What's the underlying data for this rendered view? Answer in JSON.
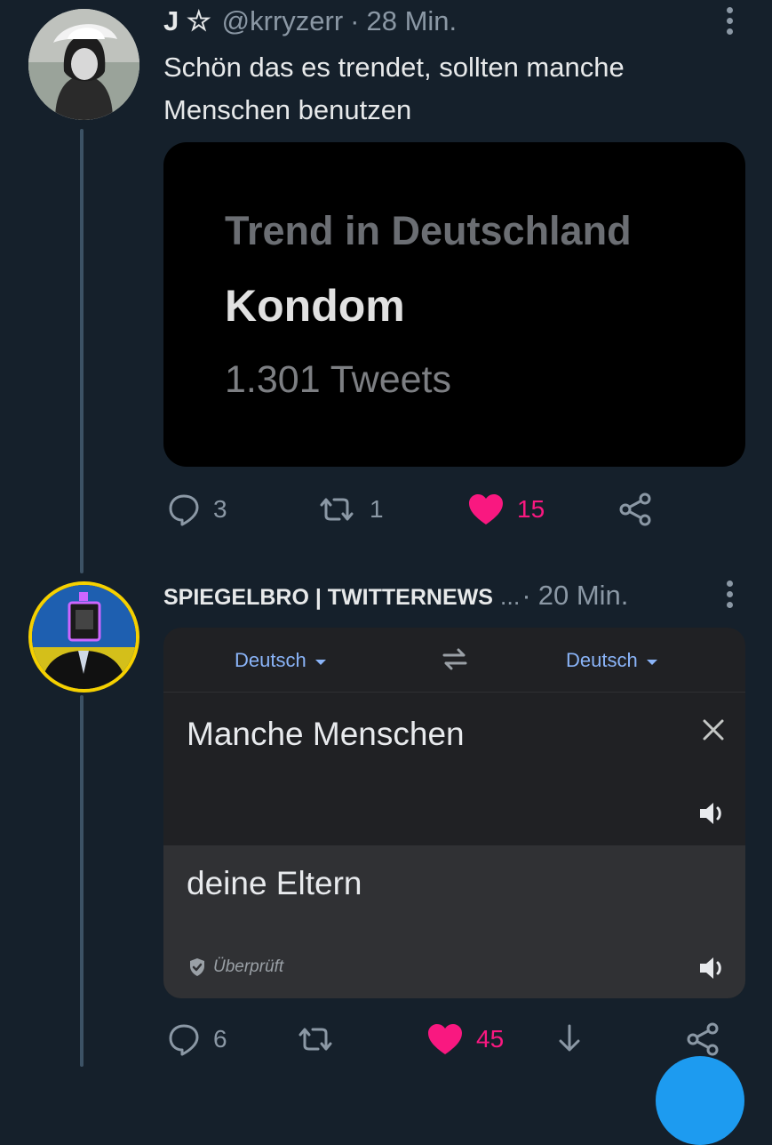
{
  "tweet1": {
    "name": "J ☆",
    "handle": "@krryzerr",
    "separator": "·",
    "time": "28 Min.",
    "text": "Schön das es trendet, sollten manche Menschen benutzen",
    "card": {
      "label": "Trend in Deutschland",
      "topic": "Kondom",
      "count": "1.301 Tweets"
    },
    "actions": {
      "replies": "3",
      "retweets": "1",
      "likes": "15"
    }
  },
  "tweet2": {
    "name": "SPIEGELBRO | TWITTERNEWS",
    "ellipsis": "...",
    "separator": "·",
    "time": "20 Min.",
    "translate": {
      "source_lang": "Deutsch",
      "target_lang": "Deutsch",
      "source_text": "Manche Menschen",
      "target_text": "deine Eltern",
      "verified_label": "Überprüft"
    },
    "actions": {
      "replies": "6",
      "likes": "45"
    }
  },
  "colors": {
    "background": "#15202b",
    "like": "#f91880",
    "link": "#8ab4f8",
    "accent": "#1d9bf0"
  },
  "icons": [
    "reply-icon",
    "retweet-icon",
    "heart-icon",
    "share-icon",
    "bookmark-icon",
    "swap-icon",
    "close-icon",
    "speaker-icon",
    "shield-check-icon",
    "more-icon"
  ]
}
